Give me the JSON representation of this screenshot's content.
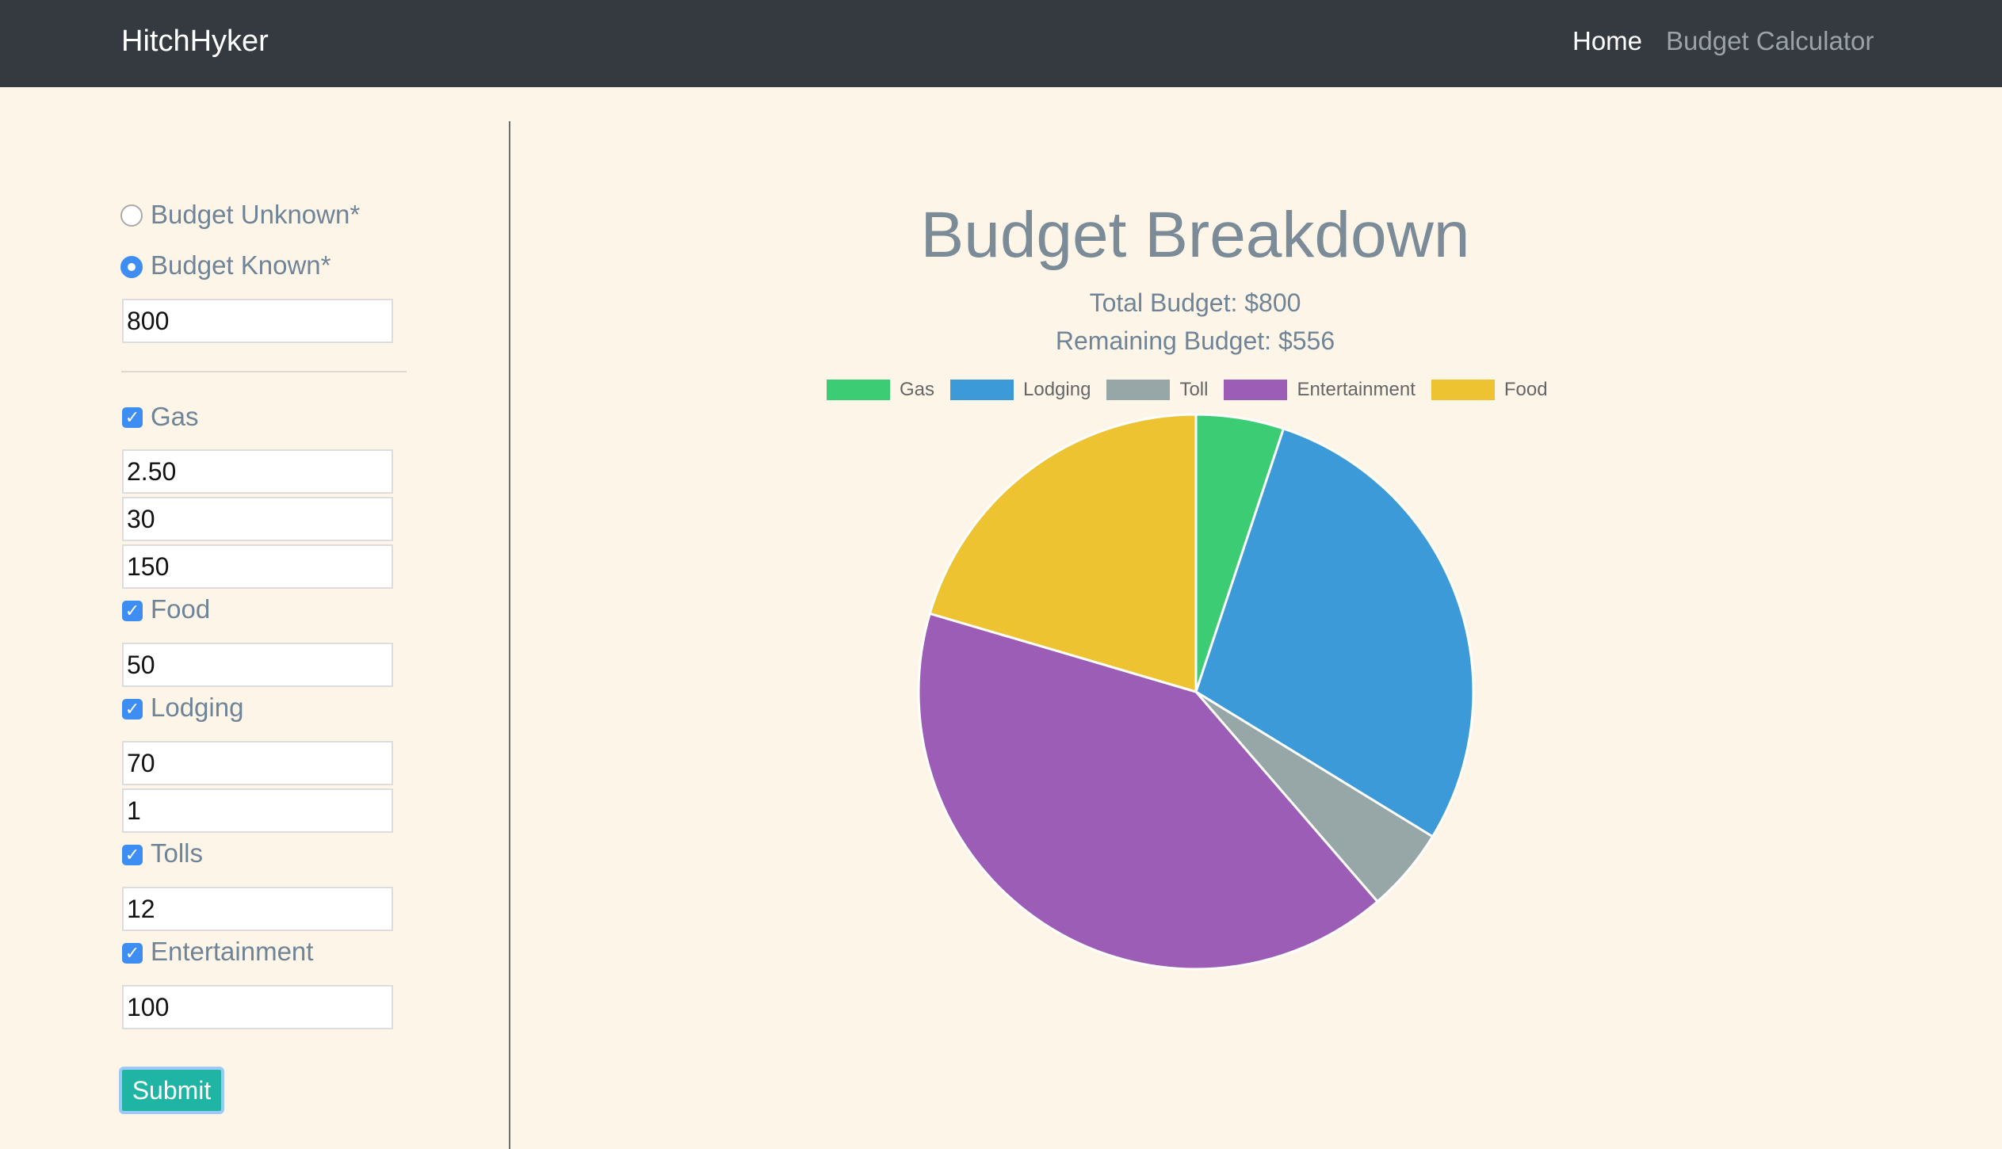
{
  "navbar": {
    "brand": "HitchHyker",
    "links": [
      "Home",
      "Budget Calculator"
    ]
  },
  "sidebar": {
    "budget_mode": {
      "unknown_label": "Budget Unknown*",
      "known_label": "Budget Known*",
      "selected": "known"
    },
    "budget_value": "800",
    "categories": {
      "gas": {
        "label": "Gas",
        "checked": true,
        "values": [
          "2.50",
          "30",
          "150"
        ]
      },
      "food": {
        "label": "Food",
        "checked": true,
        "values": [
          "50"
        ]
      },
      "lodging": {
        "label": "Lodging",
        "checked": true,
        "values": [
          "70",
          "1"
        ]
      },
      "tolls": {
        "label": "Tolls",
        "checked": true,
        "values": [
          "12"
        ]
      },
      "entertainment": {
        "label": "Entertainment",
        "checked": true,
        "values": [
          "100"
        ]
      }
    },
    "submit_label": "Submit"
  },
  "main": {
    "title": "Budget Breakdown",
    "total_budget": "Total Budget: $800",
    "remaining_budget": "Remaining Budget: $556"
  },
  "chart_data": {
    "type": "pie",
    "title": "Budget Breakdown",
    "labels": [
      "Gas",
      "Lodging",
      "Toll",
      "Entertainment",
      "Food"
    ],
    "values": [
      12.5,
      70,
      12,
      100,
      50
    ],
    "colors": [
      "#3ccc74",
      "#3c9ad9",
      "#97a6a6",
      "#9b5db5",
      "#eec331"
    ],
    "legend_position": "top"
  }
}
